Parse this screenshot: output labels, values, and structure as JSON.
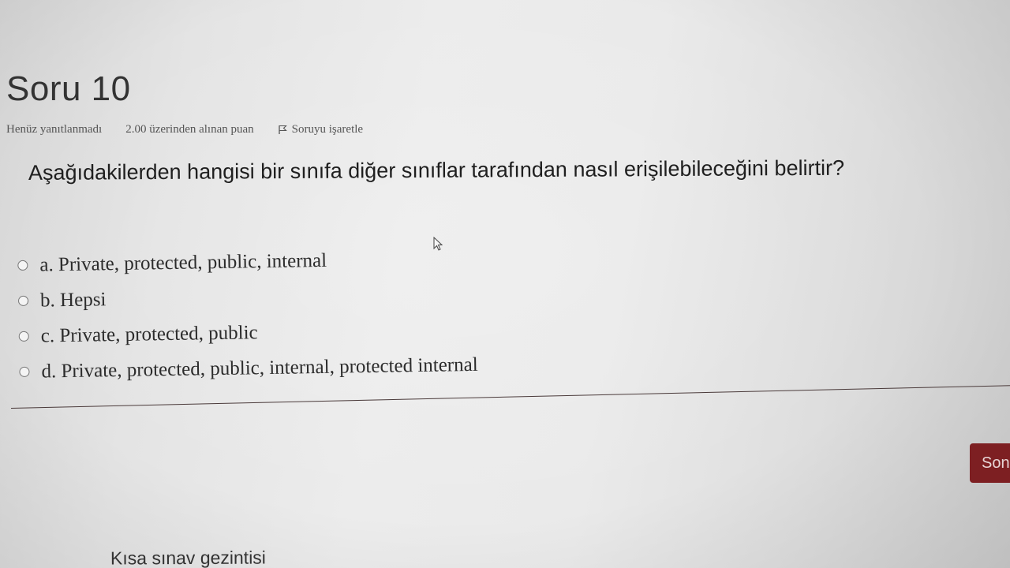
{
  "question": {
    "title": "Soru 10",
    "state": "Henüz yanıtlanmadı",
    "grade": "2.00 üzerinden alınan puan",
    "flag_label": "Soruyu işaretle",
    "flag_icon": "flag-icon",
    "text": "Aşağıdakilerden hangisi bir sınıfa diğer sınıflar tarafından nasıl erişilebileceğini belirtir?"
  },
  "answers": [
    {
      "label": "a. Private, protected, public, internal",
      "selected": false
    },
    {
      "label": "b. Hepsi",
      "selected": false
    },
    {
      "label": "c. Private, protected, public",
      "selected": false
    },
    {
      "label": "d. Private, protected, public, internal, protected internal",
      "selected": false
    }
  ],
  "navigation": {
    "next_label": "Son",
    "quiz_nav_title": "Kısa sınav gezintisi"
  },
  "colors": {
    "button_bg": "#7d1f22",
    "text": "#2a2a2a"
  }
}
